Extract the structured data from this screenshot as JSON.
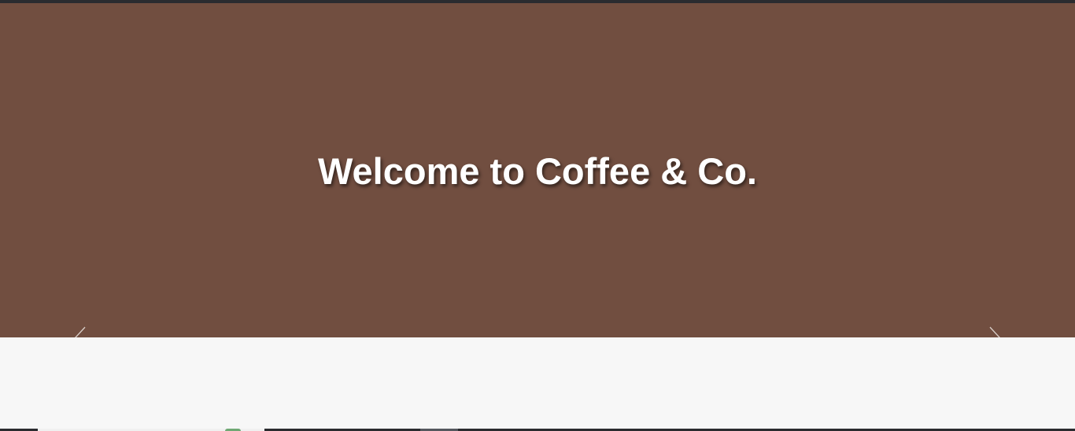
{
  "hero": {
    "title": "Welcome to Coffee & Co.",
    "background_color": "#714e40",
    "prev_icon": "chevron-left-icon",
    "next_icon": "chevron-right-icon"
  },
  "colors": {
    "page_background": "#f7f7f7",
    "dark_bar": "#2a2b2f",
    "title_text": "#ffffff"
  }
}
